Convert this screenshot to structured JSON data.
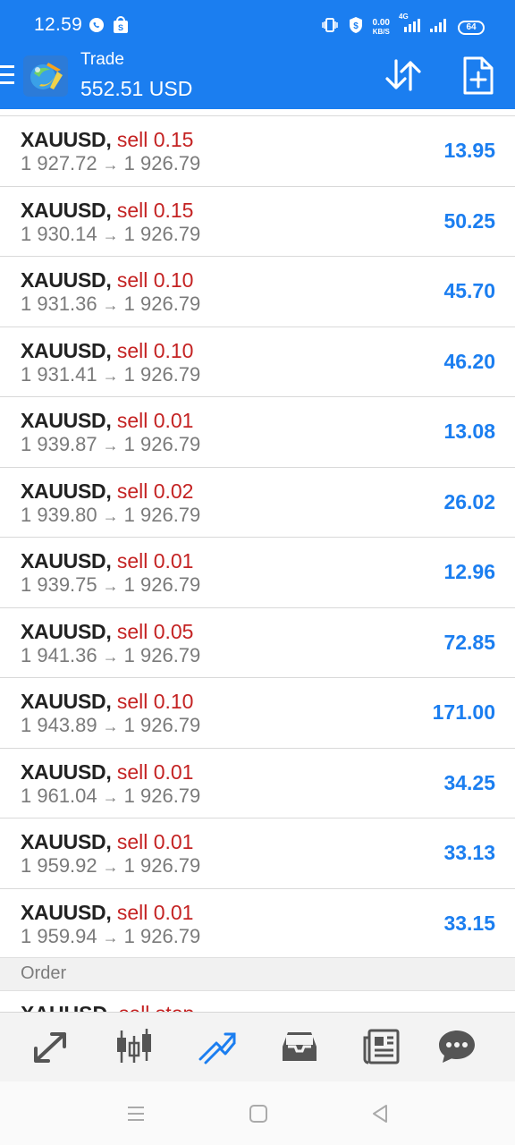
{
  "status_bar": {
    "time": "12.59",
    "net_speed_value": "0.00",
    "net_speed_unit": "KB/S",
    "network_type": "4G",
    "battery": "64"
  },
  "header": {
    "title": "Trade",
    "balance": "552.51 USD"
  },
  "positions": [
    {
      "symbol": "XAUUSD,",
      "side": "sell 0.15",
      "open": "1 927.72",
      "current": "1 926.79",
      "profit": "13.95"
    },
    {
      "symbol": "XAUUSD,",
      "side": "sell 0.15",
      "open": "1 930.14",
      "current": "1 926.79",
      "profit": "50.25"
    },
    {
      "symbol": "XAUUSD,",
      "side": "sell 0.10",
      "open": "1 931.36",
      "current": "1 926.79",
      "profit": "45.70"
    },
    {
      "symbol": "XAUUSD,",
      "side": "sell 0.10",
      "open": "1 931.41",
      "current": "1 926.79",
      "profit": "46.20"
    },
    {
      "symbol": "XAUUSD,",
      "side": "sell 0.01",
      "open": "1 939.87",
      "current": "1 926.79",
      "profit": "13.08"
    },
    {
      "symbol": "XAUUSD,",
      "side": "sell 0.02",
      "open": "1 939.80",
      "current": "1 926.79",
      "profit": "26.02"
    },
    {
      "symbol": "XAUUSD,",
      "side": "sell 0.01",
      "open": "1 939.75",
      "current": "1 926.79",
      "profit": "12.96"
    },
    {
      "symbol": "XAUUSD,",
      "side": "sell 0.05",
      "open": "1 941.36",
      "current": "1 926.79",
      "profit": "72.85"
    },
    {
      "symbol": "XAUUSD,",
      "side": "sell 0.10",
      "open": "1 943.89",
      "current": "1 926.79",
      "profit": "171.00"
    },
    {
      "symbol": "XAUUSD,",
      "side": "sell 0.01",
      "open": "1 961.04",
      "current": "1 926.79",
      "profit": "34.25"
    },
    {
      "symbol": "XAUUSD,",
      "side": "sell 0.01",
      "open": "1 959.92",
      "current": "1 926.79",
      "profit": "33.13"
    },
    {
      "symbol": "XAUUSD,",
      "side": "sell 0.01",
      "open": "1 959.94",
      "current": "1 926.79",
      "profit": "33.15"
    }
  ],
  "order_section": {
    "label": "Order",
    "partial_symbol": "XAUUSD,",
    "partial_side": "sell stop"
  },
  "arrow_glyph": "→",
  "colors": {
    "primary_blue": "#1b7ef0",
    "sell_red": "#c42222",
    "muted_gray": "#7a7a7a"
  },
  "bottom_nav": [
    {
      "icon": "quotes-icon"
    },
    {
      "icon": "chart-icon"
    },
    {
      "icon": "trade-icon",
      "active": true
    },
    {
      "icon": "history-icon"
    },
    {
      "icon": "news-icon"
    },
    {
      "icon": "messages-icon"
    }
  ]
}
